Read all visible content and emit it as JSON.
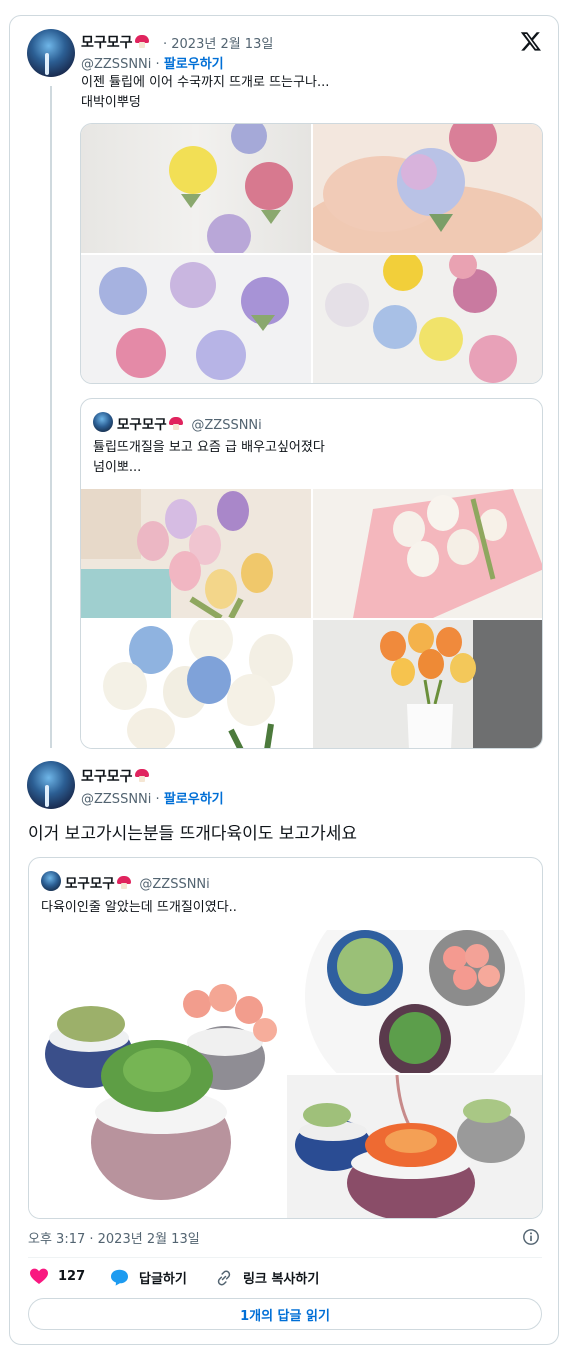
{
  "tweet1": {
    "name": "모구모구",
    "date": "· 2023년 2월 13일",
    "handle": "@ZZSSNNi",
    "dot": "·",
    "follow": "팔로우하기",
    "text_line1": "이젠 튤립에 이어 수국까지 뜨개로 뜨는구나...",
    "text_line2": "대박이뿌덩"
  },
  "quote1": {
    "name": "모구모구",
    "handle": "@ZZSSNNi",
    "text_line1": "튤립뜨개질을 보고 요즘 급 배우고싶어졌다",
    "text_line2": "넘이뽀..."
  },
  "tweet2": {
    "name": "모구모구",
    "handle": "@ZZSSNNi",
    "dot": "·",
    "follow": "팔로우하기",
    "text": "이거 보고가시는분들 뜨개다육이도 보고가세요"
  },
  "quote2": {
    "name": "모구모구",
    "handle": "@ZZSSNNi",
    "text": "다육이인줄 알았는데 뜨개질이였다.."
  },
  "footer": {
    "timestamp": "오후 3:17 · 2023년 2월 13일",
    "likes": "127",
    "reply": "답글하기",
    "copy_link": "링크 복사하기",
    "read_replies": "1개의 답글 읽기"
  },
  "colors": {
    "like": "#f91880",
    "reply": "#1d9bf0",
    "follow": "#006fd6",
    "border": "#cfd9de"
  },
  "icons": [
    "x-logo-icon",
    "mushroom-emoji-icon",
    "heart-icon",
    "speech-bubble-icon",
    "link-icon",
    "info-icon"
  ]
}
